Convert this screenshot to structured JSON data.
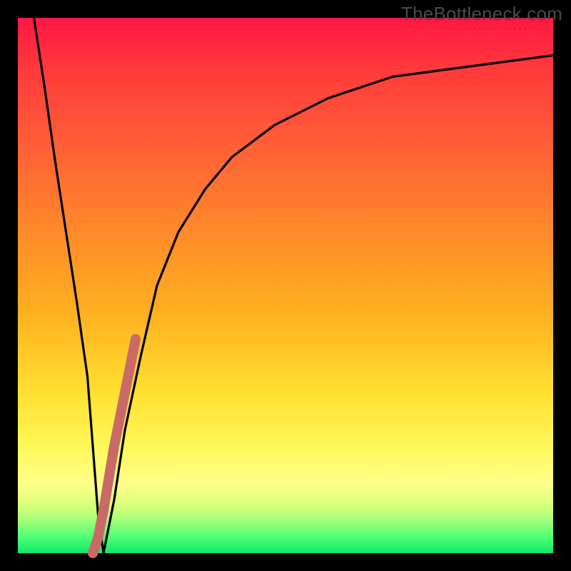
{
  "watermark": "TheBottleneck.com",
  "chart_data": {
    "type": "line",
    "title": "",
    "xlabel": "",
    "ylabel": "",
    "xlim": [
      0,
      100
    ],
    "ylim": [
      0,
      100
    ],
    "series": [
      {
        "name": "black-curve",
        "color": "#000000",
        "x": [
          3,
          5,
          7,
          9,
          11,
          13,
          14,
          15,
          16,
          18,
          20,
          23,
          26,
          30,
          35,
          40,
          48,
          58,
          70,
          85,
          100
        ],
        "values": [
          100,
          87,
          73,
          60,
          47,
          33,
          20,
          7,
          0,
          10,
          23,
          37,
          50,
          60,
          68,
          74,
          80,
          85,
          89,
          91,
          93
        ]
      },
      {
        "name": "highlight-segment",
        "color": "#c96a67",
        "x": [
          14,
          15,
          16,
          17,
          18,
          19,
          20,
          21,
          22
        ],
        "values": [
          0,
          3,
          8,
          14,
          20,
          25,
          30,
          35,
          40
        ]
      }
    ],
    "gradient_stops": [
      {
        "y": 100,
        "color": "#ff1744"
      },
      {
        "y": 70,
        "color": "#ffb020"
      },
      {
        "y": 30,
        "color": "#ffff8a"
      },
      {
        "y": 0,
        "color": "#12e86a"
      }
    ]
  }
}
